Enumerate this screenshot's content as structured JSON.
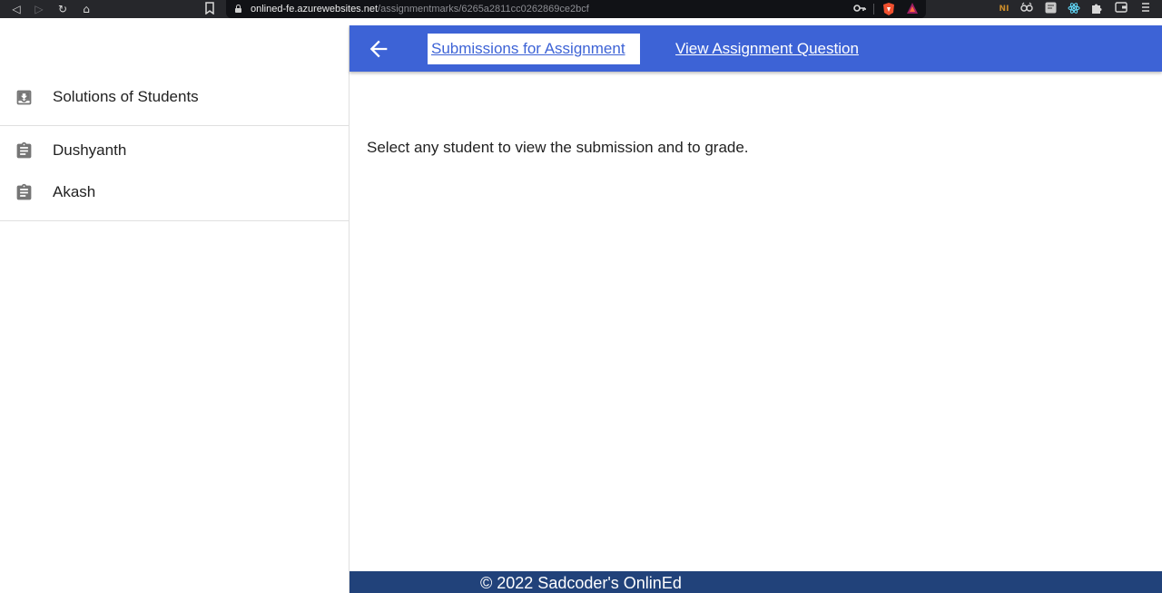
{
  "browser": {
    "url_host": "onlined-fe.azurewebsites.net",
    "url_path": "/assignmentmarks/6265a2811cc0262869ce2bcf",
    "icons": [
      "back-icon",
      "forward-icon",
      "reload-icon",
      "home-icon",
      "bookmark-icon",
      "key-icon",
      "brave-shield-icon",
      "brave-rewards-icon",
      "extension-ni-icon",
      "extension-glasses-icon",
      "extension-note-icon",
      "react-devtools-icon",
      "puzzle-icon",
      "wallet-icon",
      "menu-icon"
    ]
  },
  "sidebar": {
    "section_title": "Solutions of Students",
    "section_icon": "download-box-icon",
    "students": [
      {
        "name": "Dushyanth",
        "icon": "clipboard-icon"
      },
      {
        "name": "Akash",
        "icon": "clipboard-icon"
      }
    ]
  },
  "header": {
    "back_icon": "arrow-left-icon",
    "tabs": [
      {
        "label": "Submissions for Assignment",
        "active": true
      },
      {
        "label": "View Assignment Question",
        "active": false
      }
    ],
    "color": "#3d63d6"
  },
  "main": {
    "message": "Select any student to view the submission and to grade."
  },
  "footer": {
    "text": "© 2022 Sadcoder's OnlinEd",
    "color": "#21427a"
  }
}
